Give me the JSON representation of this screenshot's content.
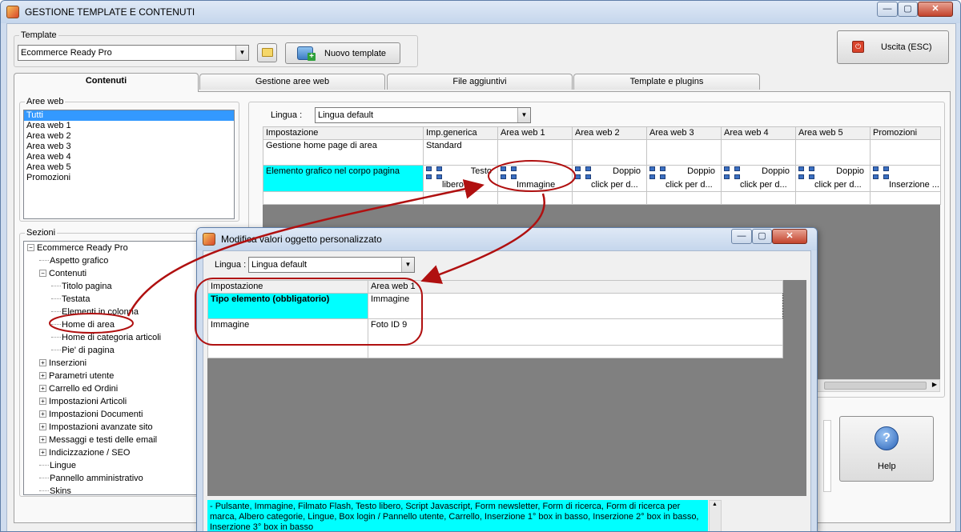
{
  "window": {
    "title": "GESTIONE TEMPLATE E CONTENUTI",
    "controls": [
      "—",
      "▢",
      "✕"
    ]
  },
  "template": {
    "label": "Template",
    "selected": "Ecommerce Ready Pro",
    "new_button": "Nuovo template"
  },
  "exit_button": "Uscita (ESC)",
  "help_button": "Help",
  "tabs": [
    "Contenuti",
    "Gestione aree web",
    "File aggiuntivi",
    "Template e plugins"
  ],
  "aree_web": {
    "label": "Aree web",
    "items": [
      "Tutti",
      "Area web 1",
      "Area web 2",
      "Area web 3",
      "Area web 4",
      "Area web 5",
      "Promozioni"
    ]
  },
  "lingua": {
    "label": "Lingua :",
    "selected": "Lingua default"
  },
  "main_grid": {
    "headers": [
      "Impostazione",
      "Imp.generica",
      "Area web 1",
      "Area web 2",
      "Area web 3",
      "Area web 4",
      "Area web 5",
      "Promozioni"
    ],
    "row1": {
      "label": "Gestione home page di area",
      "generic": "Standard"
    },
    "row2": {
      "label": "Elemento grafico nel corpo pagina",
      "cells": [
        [
          "Testo",
          "libero"
        ],
        [
          "",
          "Immagine"
        ],
        [
          "Doppio",
          "click per d..."
        ],
        [
          "Doppio",
          "click per d..."
        ],
        [
          "Doppio",
          "click per d..."
        ],
        [
          "Doppio",
          "click per d..."
        ],
        [
          "",
          "Inserzione ..."
        ]
      ]
    }
  },
  "sezioni": {
    "label": "Sezioni",
    "items": [
      {
        "t": "Ecommerce Ready Pro",
        "lvl": 0,
        "exp": "−"
      },
      {
        "t": "Aspetto grafico",
        "lvl": 1
      },
      {
        "t": "Contenuti",
        "lvl": 1,
        "exp": "−"
      },
      {
        "t": "Titolo pagina",
        "lvl": 2
      },
      {
        "t": "Testata",
        "lvl": 2
      },
      {
        "t": "Elementi in colonna",
        "lvl": 2
      },
      {
        "t": "Home di area",
        "lvl": 2
      },
      {
        "t": "Home di categoria articoli",
        "lvl": 2
      },
      {
        "t": "Pie' di pagina",
        "lvl": 2
      },
      {
        "t": "Inserzioni",
        "lvl": 1,
        "exp": "+"
      },
      {
        "t": "Parametri utente",
        "lvl": 1,
        "exp": "+"
      },
      {
        "t": "Carrello ed Ordini",
        "lvl": 1,
        "exp": "+"
      },
      {
        "t": "Impostazioni Articoli",
        "lvl": 1,
        "exp": "+"
      },
      {
        "t": "Impostazioni Documenti",
        "lvl": 1,
        "exp": "+"
      },
      {
        "t": "Impostazioni avanzate sito",
        "lvl": 1,
        "exp": "+"
      },
      {
        "t": "Messaggi e testi delle email",
        "lvl": 1,
        "exp": "+"
      },
      {
        "t": "Indicizzazione / SEO",
        "lvl": 1,
        "exp": "+"
      },
      {
        "t": "Lingue",
        "lvl": 1
      },
      {
        "t": "Pannello amministrativo",
        "lvl": 1
      },
      {
        "t": "Skins",
        "lvl": 1
      }
    ]
  },
  "dialog": {
    "title": "Modifica valori oggetto personalizzato",
    "lingua_label": "Lingua :",
    "lingua_selected": "Lingua default",
    "headers": [
      "Impostazione",
      "Area web 1"
    ],
    "rows": [
      {
        "label": "Tipo elemento (obbligatorio)",
        "value": "Immagine"
      },
      {
        "label": "Immagine",
        "value": "Foto ID 9"
      }
    ],
    "info": "- Pulsante, Immagine, Filmato Flash, Testo libero, Script Javascript, Form newsletter, Form di ricerca, Form di ricerca per marca, Albero categorie, Lingue, Box login / Pannello utente, Carrello, Inserzione 1° box in basso, Inserzione 2° box in basso, Inserzione 3° box in basso"
  },
  "colors": {
    "selection": "#3399ff",
    "highlight_cell": "#00ffff",
    "annotation": "#b01010"
  }
}
